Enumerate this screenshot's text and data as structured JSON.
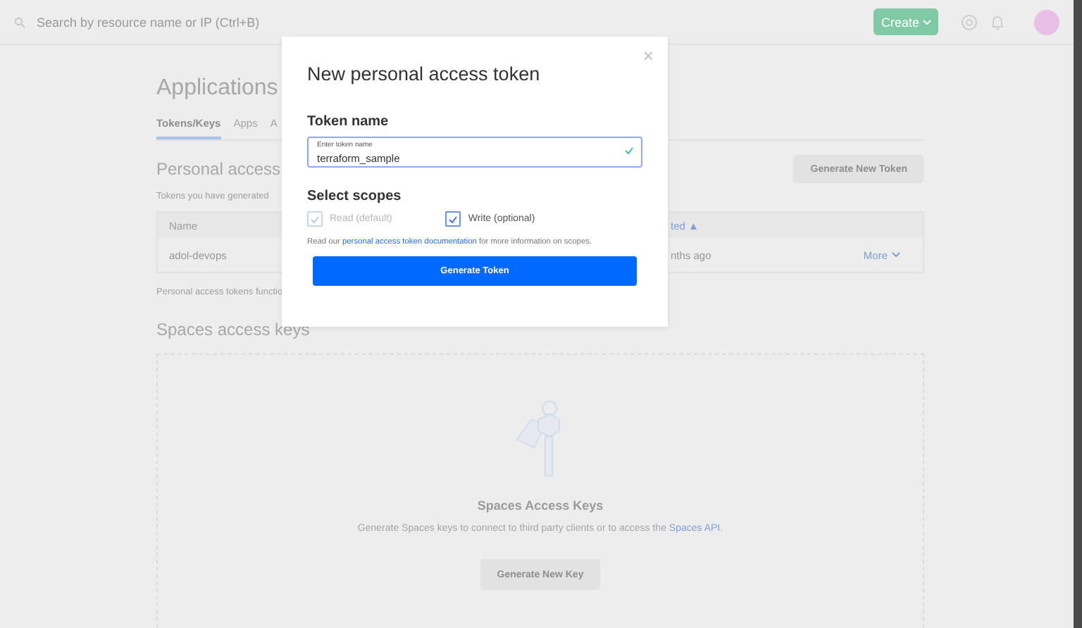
{
  "topbar": {
    "search_placeholder": "Search by resource name or IP (Ctrl+B)",
    "create_button": "Create"
  },
  "page": {
    "title": "Applications",
    "tabs": [
      {
        "label": "Tokens/Keys",
        "selected": true
      },
      {
        "label": "Apps",
        "selected": false
      },
      {
        "label": "A",
        "selected": false
      }
    ],
    "personal_section": {
      "title": "Personal access",
      "subtitle": "Tokens you have generated",
      "generate_button": "Generate New Token",
      "table": {
        "columns": [
          "Name",
          "ted ▲"
        ],
        "rows": [
          {
            "name": "adol-devops",
            "column_2": "nths ago",
            "action": "More"
          }
        ]
      },
      "note": "Personal access tokens functio"
    },
    "spaces_section": {
      "title": "Spaces access keys",
      "empty_title": "Spaces Access Keys",
      "empty_text": "Generate Spaces keys to connect to third party clients or to access the ",
      "empty_link": "Spaces API",
      "empty_text_end": ".",
      "button": "Generate New Key"
    }
  },
  "modal": {
    "title": "New personal access token",
    "close": "×",
    "token_name_label": "Token name",
    "field_label": "Enter token name",
    "field_value": "terraform_sample",
    "field_valid": true,
    "scopes_label": "Select scopes",
    "scopes": [
      {
        "label": "Read (default)",
        "checked": true,
        "disabled": true
      },
      {
        "label": "Write (optional)",
        "checked": true,
        "disabled": false
      }
    ],
    "info_before": "Read our ",
    "info_link": "personal access token documentation",
    "info_after": " for more information on scopes.",
    "submit": "Generate Token"
  }
}
